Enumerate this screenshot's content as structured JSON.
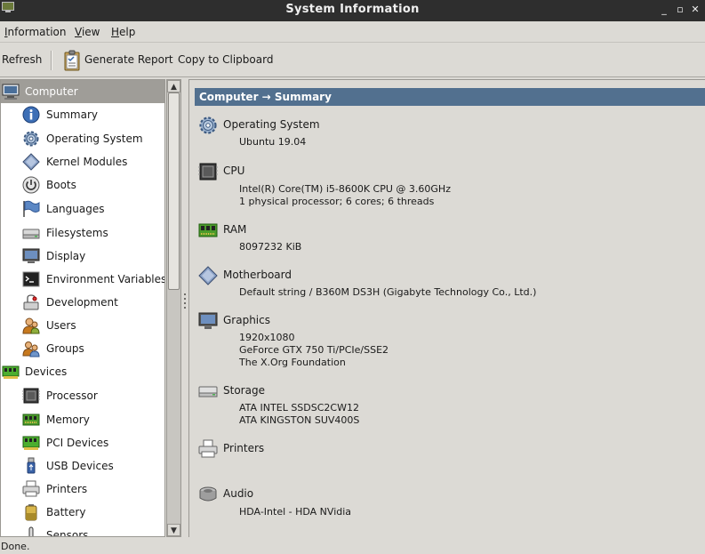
{
  "window": {
    "title": "System Information",
    "buttons": [
      "_",
      "▫",
      "✕"
    ]
  },
  "menu": [
    {
      "label": "Information"
    },
    {
      "label": "View"
    },
    {
      "label": "Help"
    }
  ],
  "toolbar": {
    "refresh_label": "Refresh",
    "report_label": "Generate Report",
    "clipboard_label": "Copy to Clipboard"
  },
  "tree": {
    "computer": {
      "label": "Computer",
      "children": [
        {
          "label": "Summary",
          "icon": "info-icon"
        },
        {
          "label": "Operating System",
          "icon": "gear-icon"
        },
        {
          "label": "Kernel Modules",
          "icon": "diamond-icon"
        },
        {
          "label": "Boots",
          "icon": "power-icon"
        },
        {
          "label": "Languages",
          "icon": "flag-icon"
        },
        {
          "label": "Filesystems",
          "icon": "drive-icon"
        },
        {
          "label": "Display",
          "icon": "monitor-icon"
        },
        {
          "label": "Environment Variables",
          "icon": "terminal-icon"
        },
        {
          "label": "Development",
          "icon": "development-icon"
        },
        {
          "label": "Users",
          "icon": "user-icon"
        },
        {
          "label": "Groups",
          "icon": "group-icon"
        }
      ]
    },
    "devices": {
      "label": "Devices",
      "children": [
        {
          "label": "Processor",
          "icon": "chip-icon"
        },
        {
          "label": "Memory",
          "icon": "memory-icon"
        },
        {
          "label": "PCI Devices",
          "icon": "pci-icon"
        },
        {
          "label": "USB Devices",
          "icon": "usb-icon"
        },
        {
          "label": "Printers",
          "icon": "printer-icon"
        },
        {
          "label": "Battery",
          "icon": "battery-icon"
        },
        {
          "label": "Sensors",
          "icon": "sensor-icon"
        }
      ]
    }
  },
  "content": {
    "header": "Computer → Summary",
    "sections": [
      {
        "title": "Operating System",
        "icon": "gear-icon",
        "lines": [
          "Ubuntu 19.04"
        ]
      },
      {
        "title": "CPU",
        "icon": "chip-icon",
        "lines": [
          "Intel(R) Core(TM) i5-8600K CPU @ 3.60GHz",
          "1 physical processor; 6 cores; 6 threads"
        ]
      },
      {
        "title": "RAM",
        "icon": "memory-icon",
        "lines": [
          "8097232 KiB"
        ]
      },
      {
        "title": "Motherboard",
        "icon": "diamond-icon",
        "lines": [
          "Default string / B360M DS3H (Gigabyte Technology Co., Ltd.)"
        ]
      },
      {
        "title": "Graphics",
        "icon": "monitor-icon",
        "lines": [
          "1920x1080",
          "GeForce GTX 750 Ti/PCIe/SSE2",
          "The X.Org Foundation"
        ]
      },
      {
        "title": "Storage",
        "icon": "drive-icon",
        "lines": [
          "ATA INTEL SSDSC2CW12",
          "ATA KINGSTON SUV400S"
        ]
      },
      {
        "title": "Printers",
        "icon": "printer-icon",
        "lines": []
      },
      {
        "title": "Audio",
        "icon": "audio-icon",
        "lines": [
          "HDA-Intel - HDA NVidia"
        ]
      }
    ]
  },
  "status": "Done.",
  "colors": {
    "header_bg": "#52708f",
    "selected_bg": "#9f9d98",
    "titlebar_bg": "#2e2e2e"
  }
}
